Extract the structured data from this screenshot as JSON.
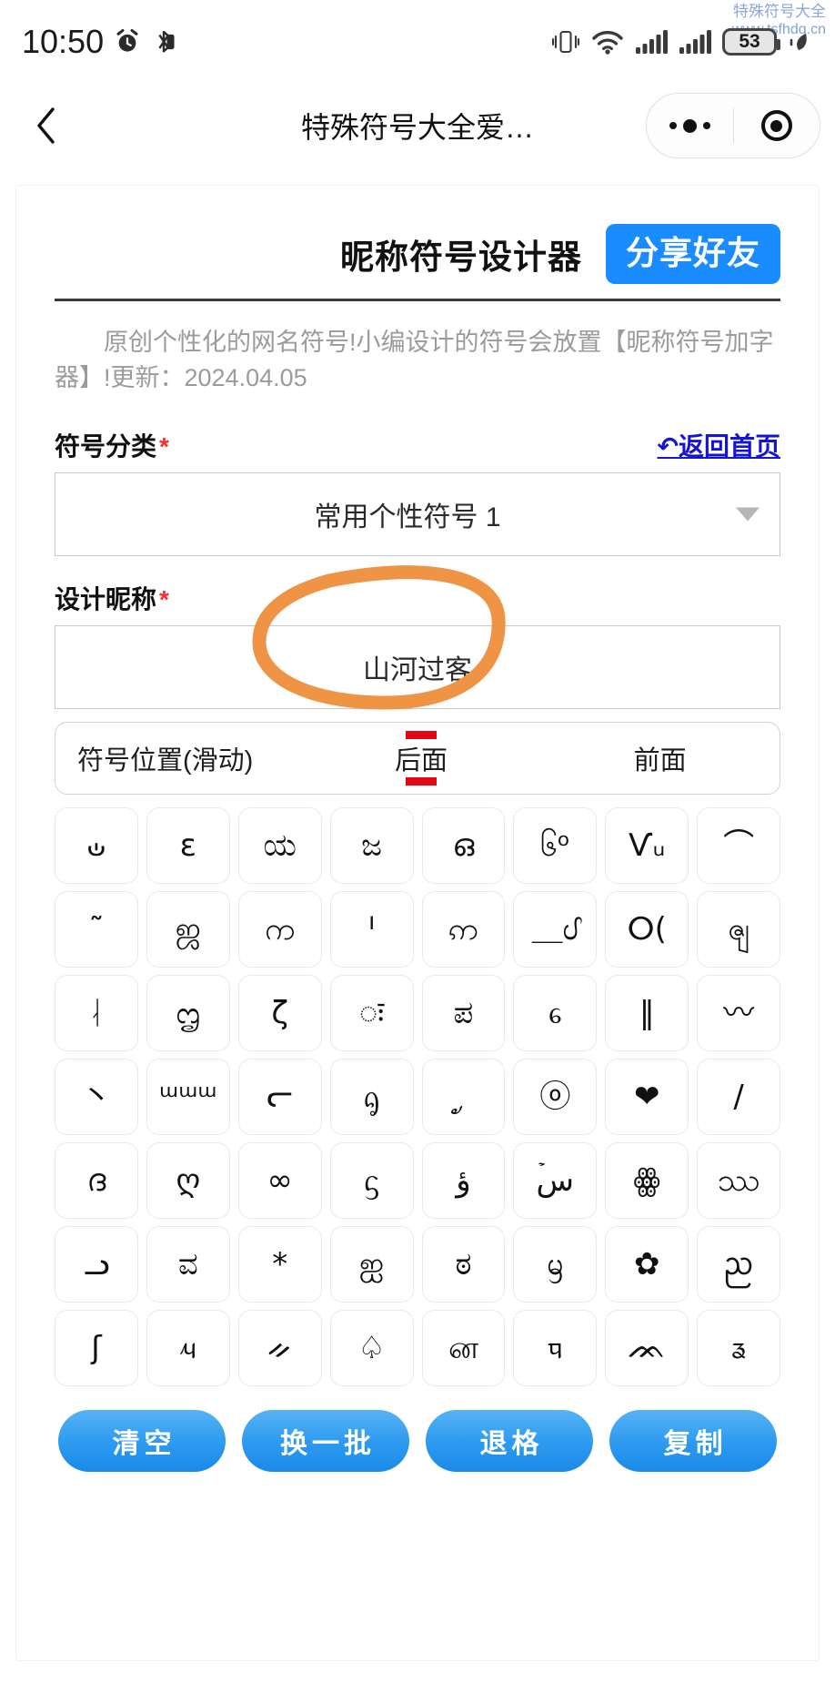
{
  "watermark": {
    "brand": "特殊符号大全",
    "url": "www.tsfhdq.cn"
  },
  "statusbar": {
    "time": "10:50",
    "battery_percent": "53",
    "icons": [
      "alarm-icon",
      "bluetooth-icon",
      "vibrate-icon",
      "wifi-icon",
      "signal-icon",
      "signal-icon",
      "battery-icon",
      "power-saving-icon"
    ]
  },
  "navbar": {
    "back_icon": "chevron-left-icon",
    "title": "特殊符号大全爱…",
    "more_icon": "more-dots-icon",
    "target_icon": "target-icon"
  },
  "header": {
    "app_title": "昵称符号设计器",
    "share_label": "分享好友",
    "share_color": "#1a8cff"
  },
  "description": "原创个性化的网名符号!小编设计的符号会放置【昵称符号加字器】!更新：2024.04.05",
  "form": {
    "category_label": "符号分类",
    "required_mark": "*",
    "home_link": "↶返回首页",
    "category_value": "常用个性符号 1",
    "nickname_label": "设计昵称",
    "nickname_value": "山河过客"
  },
  "position_bar": {
    "label": "符号位置(滑动)",
    "tabs": [
      "后面",
      "前面"
    ],
    "active_index": 0,
    "tick_color": "#e30613"
  },
  "symbol_grid": {
    "rows": 7,
    "cols": 8,
    "symbols": [
      "ഄ",
      "ε",
      "ಯ",
      "ಜ",
      "ഒ",
      "၆ᵒ",
      "Ѵᵤ",
      "⌒",
      "˜",
      "ஜ",
      "က",
      "ᑊ",
      "ဢ",
      "＿ᦔ",
      "ⵔ(",
      "ၛ",
      "ᛆ",
      "ᦗ",
      "ζ",
      "ः",
      "ಪ",
      "ᧈ",
      "‖",
      "〰",
      "丶",
      "ᵚᵚᵚ",
      "ᓕ",
      "ᧂ",
      "ᤢ",
      "ⓞ",
      "❤",
      "/",
      "ദ",
      "ღ",
      "∞",
      "ᦓ",
      "ؤ",
      "ۡس",
      "ꙮ",
      "ဿ",
      "ᓗ",
      "ವ",
      "*",
      "ஐ",
      "ಠ",
      "ᦙ",
      "✿",
      "ᨬ",
      "ʃ",
      "ᤘ",
      "ᨀ",
      "♤",
      "ன",
      "ᤄ",
      "ᨏ",
      "ᤕ"
    ]
  },
  "actions": [
    "清空",
    "换一批",
    "退格",
    "复制"
  ],
  "annotation": {
    "shape": "hand-drawn-circle",
    "color": "#ef9344"
  }
}
